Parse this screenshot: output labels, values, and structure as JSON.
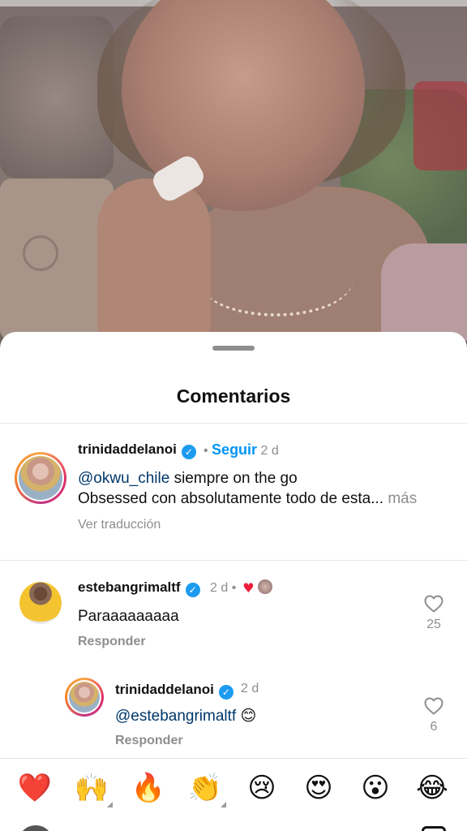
{
  "sheet": {
    "title": "Comentarios"
  },
  "comments": [
    {
      "username": "trinidaddelanoi",
      "follow_label": "Seguir",
      "time": "2 d",
      "mention": "@okwu_chile",
      "text_line1": " siempre on the go",
      "text_line2": "Obsessed con absolutamente todo de esta...",
      "more_label": " más",
      "translate_label": "Ver traducción"
    },
    {
      "username": "estebangrimaltf",
      "time": "2 d",
      "text": "Paraaaaaaaaa",
      "reply_label": "Responder",
      "likes": "25"
    },
    {
      "username": "trinidaddelanoi",
      "time": "2 d",
      "mention": "@estebangrimaltf",
      "emoji": " 😊",
      "reply_label": "Responder",
      "likes": "6"
    }
  ],
  "reactions": [
    "❤️",
    "🙌",
    "🔥",
    "👏",
    "😢",
    "😍",
    "😮",
    "😂"
  ],
  "icons": {
    "verified": "verified-badge-icon",
    "heart": "heart-outline-icon"
  },
  "colors": {
    "accent": "#0095f6",
    "verified": "#1d9bf0",
    "muted": "#8e8e8e",
    "heart_red": "#ed1f3c"
  }
}
